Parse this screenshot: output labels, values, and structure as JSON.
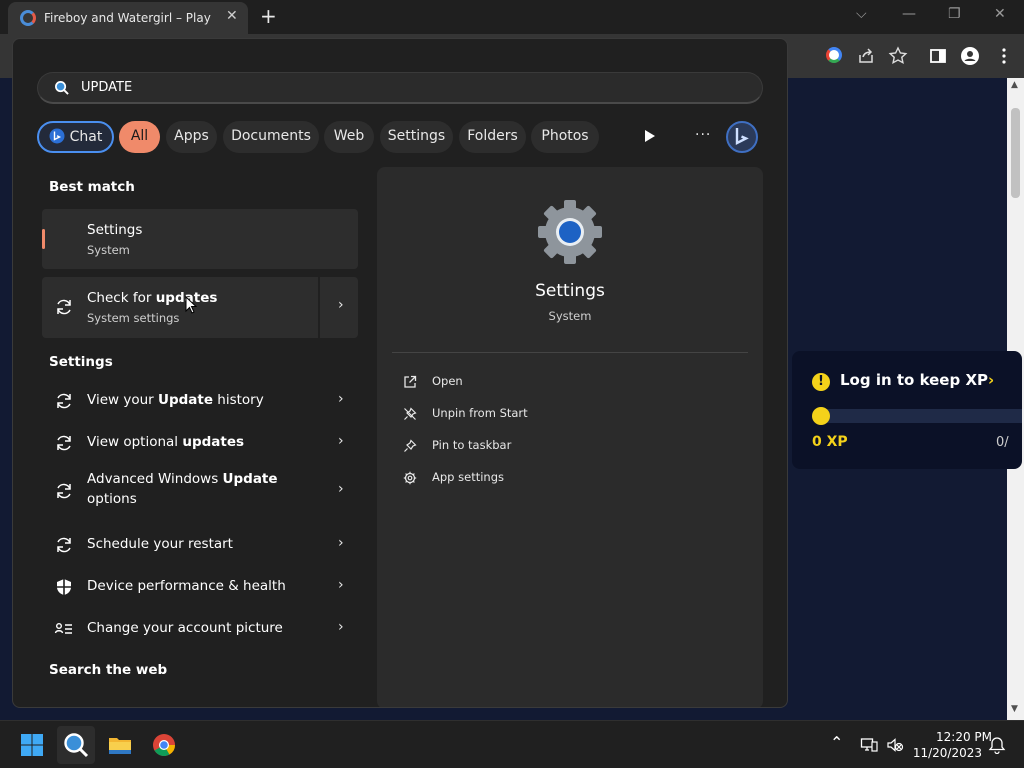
{
  "browser": {
    "tab_title": "Fireboy and Watergirl – Play Onl",
    "tab_close": "✕",
    "new_tab": "+",
    "min": "—",
    "restore": "❐",
    "close": "✕",
    "collapse": "⌵"
  },
  "webpage": {
    "xp_title": "Log in to keep XP",
    "xp_value": "0 XP",
    "xp_max": "0/",
    "xp_progress": 0
  },
  "search": {
    "query": "UPDATE",
    "filters": [
      "Chat",
      "All",
      "Apps",
      "Documents",
      "Web",
      "Settings",
      "Folders",
      "Photos"
    ],
    "active_filter": "All",
    "more": "···"
  },
  "results": {
    "best_match_heading": "Best match",
    "best_match": {
      "title": "Settings",
      "subtitle": "System"
    },
    "check_updates": {
      "title_plain": "Check for ",
      "title_bold": "updates",
      "subtitle": "System settings"
    },
    "settings_heading": "Settings",
    "settings_items": [
      {
        "pre": "View your ",
        "bold": "Update",
        "post": " history"
      },
      {
        "pre": "View optional ",
        "bold": "updates",
        "post": ""
      },
      {
        "pre": "Advanced Windows ",
        "bold": "Update",
        "post": "",
        "line2": "options"
      },
      {
        "pre": "Schedule your restart",
        "bold": "",
        "post": ""
      },
      {
        "pre": "Device performance & health",
        "bold": "",
        "post": ""
      },
      {
        "pre": "Change your account picture",
        "bold": "",
        "post": ""
      }
    ],
    "web_heading": "Search the web"
  },
  "detail": {
    "app_name": "Settings",
    "app_category": "System",
    "actions": [
      "Open",
      "Unpin from Start",
      "Pin to taskbar",
      "App settings"
    ]
  },
  "taskbar": {
    "time": "12:20 PM",
    "date": "11/20/2023",
    "tray_up": "⌃"
  },
  "colors": {
    "accent": "#f08a6a",
    "chat_border": "#4a8ff0",
    "xp_yellow": "#f4d21a"
  }
}
